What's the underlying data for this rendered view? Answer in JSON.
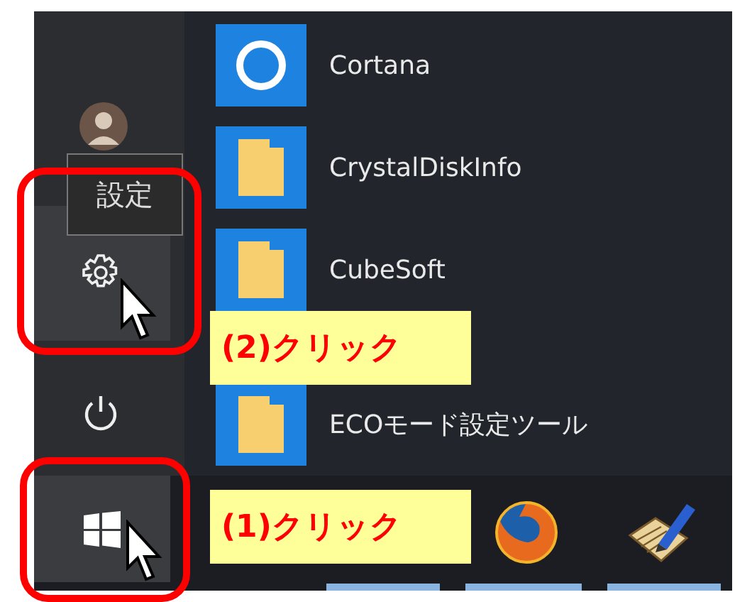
{
  "tooltip": {
    "text": "設定"
  },
  "apps": [
    {
      "name": "Cortana",
      "kind": "cortana"
    },
    {
      "name": "CrystalDiskInfo",
      "kind": "folder"
    },
    {
      "name": "CubeSoft",
      "kind": "folder"
    },
    {
      "name": "ECOモード設定ツール",
      "kind": "folder"
    }
  ],
  "callouts": [
    {
      "text": "(2)クリック"
    },
    {
      "text": "(1)クリック"
    }
  ]
}
